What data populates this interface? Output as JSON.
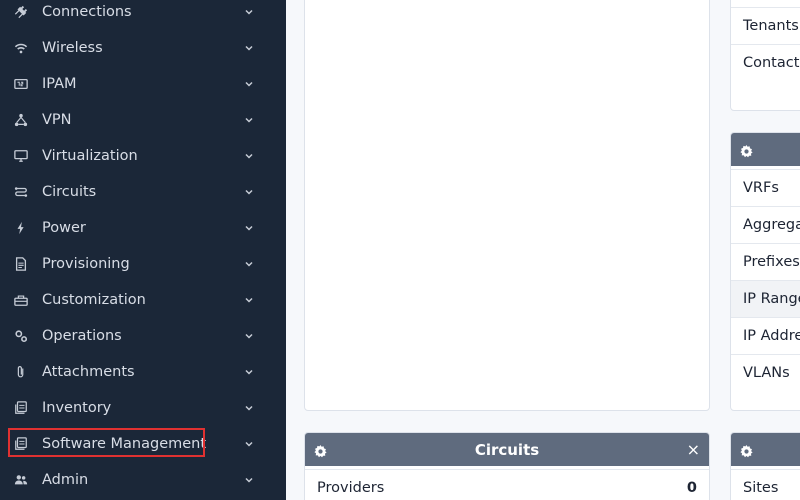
{
  "sidebar": {
    "items": [
      {
        "label": "Connections",
        "icon": "plug-icon"
      },
      {
        "label": "Wireless",
        "icon": "wifi-icon"
      },
      {
        "label": "IPAM",
        "icon": "counter-icon"
      },
      {
        "label": "VPN",
        "icon": "network-icon"
      },
      {
        "label": "Virtualization",
        "icon": "monitor-icon"
      },
      {
        "label": "Circuits",
        "icon": "transit-icon"
      },
      {
        "label": "Power",
        "icon": "lightning-icon"
      },
      {
        "label": "Provisioning",
        "icon": "file-document-icon"
      },
      {
        "label": "Customization",
        "icon": "toolbox-icon"
      },
      {
        "label": "Operations",
        "icon": "cogs-icon"
      },
      {
        "label": "Attachments",
        "icon": "paperclip-icon"
      },
      {
        "label": "Inventory",
        "icon": "inventory-icon"
      },
      {
        "label": "Software Management",
        "icon": "software-icon"
      },
      {
        "label": "Admin",
        "icon": "account-group-icon"
      }
    ],
    "highlighted_item": "Software Management"
  },
  "organization_card": {
    "rows": [
      "Tenants",
      "Contacts"
    ]
  },
  "ipam_card": {
    "rows": [
      "VRFs",
      "Aggrega",
      "Prefixes",
      "IP Range",
      "IP Addre",
      "VLANs"
    ]
  },
  "circuits_card": {
    "title": "Circuits",
    "close_label": "×",
    "rows": [
      {
        "label": "Providers",
        "value": "0"
      }
    ]
  },
  "dcim_card": {
    "rows": [
      "Sites"
    ]
  },
  "colors": {
    "sidebar_bg": "#1b2738",
    "card_header_bg": "#5f6b7e",
    "highlight": "#e03131"
  }
}
